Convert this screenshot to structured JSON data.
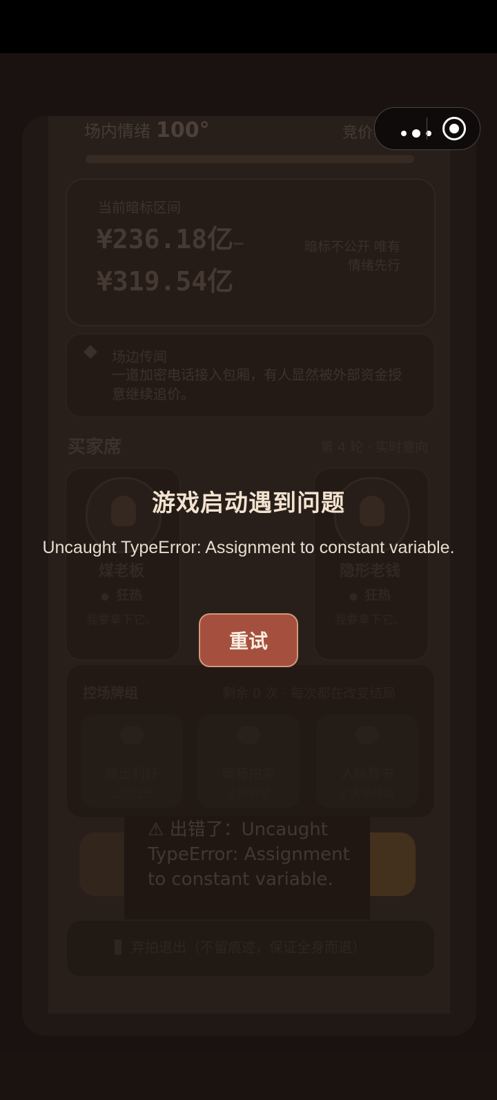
{
  "dialog": {
    "title": "游戏启动遇到问题",
    "message": "Uncaught TypeError: Assignment to constant variable.",
    "retry_label": "重试"
  },
  "capsule": {
    "more_icon": "more-dots-icon",
    "close_icon": "target-circle-icon"
  },
  "background": {
    "heat_label": "场内情绪",
    "heat_value": "100°",
    "bid_label": "竞价中",
    "range_caption": "当前暗标区间",
    "range_low": "¥236.18亿",
    "range_high": "¥319.54亿",
    "range_note": "暗标不公开 唯有情绪先行",
    "news_title": "场边传闻",
    "news_text": "一道加密电话接入包厢，有人显然被外部资金授意继续追价。",
    "buyers_title": "买家席",
    "buyers_round": "第 4 轮 · 实时意向",
    "buyers": [
      {
        "name": "煤老板",
        "status": "狂热",
        "say": "我要拿下它。"
      },
      {
        "name": "",
        "status": "",
        "say": ""
      },
      {
        "name": "隐形老钱",
        "status": "狂热",
        "say": "我要拿下它。"
      }
    ],
    "cards_title": "控场牌组",
    "cards_remain": "剩余 0 次 · 每次都在改变结局",
    "cards": [
      {
        "name": "放出利好",
        "desc": "二次拉升"
      },
      {
        "name": "暗箱拍卖",
        "desc": "全场震动"
      },
      {
        "name": "人脉背书",
        "desc": "扩大情绪面"
      }
    ],
    "error_toast": "⚠ 出错了：Uncaught TypeError: Assignment to constant variable.",
    "exit_text": "弃拍退出（不留痕迹，保证全身而退）"
  }
}
